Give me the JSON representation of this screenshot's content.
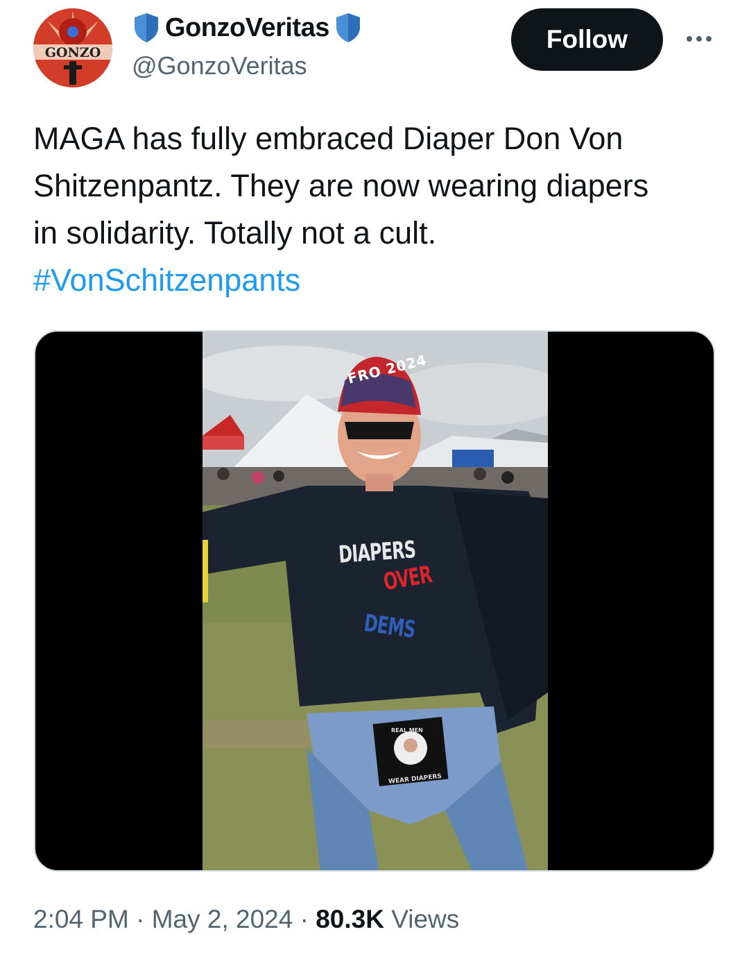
{
  "author": {
    "display_name": "GonzoVeritas",
    "handle": "@GonzoVeritas",
    "avatar_text": "GONZO",
    "badge_color": "#4a90d9"
  },
  "actions": {
    "follow_label": "Follow",
    "more_icon": "more-horizontal-icon"
  },
  "tweet": {
    "text_lines": [
      "MAGA has fully embraced Diaper Don Von",
      "Shitzenpantz. They are now wearing diapers",
      "in solidarity. Totally not a cult."
    ],
    "hashtag": "#VonSchitzenpants"
  },
  "media": {
    "shirt_line1": "DIAPERS",
    "shirt_line2": "OVER",
    "shirt_line3": "DEMS",
    "hat_text": "FRO 2024",
    "badge_top": "REAL MEN",
    "badge_bottom": "WEAR DIAPERS"
  },
  "meta": {
    "time": "2:04 PM",
    "separator": "·",
    "date": "May 2, 2024",
    "views_count": "80.3K",
    "views_label": "Views"
  },
  "colors": {
    "text": "#0f1419",
    "secondary": "#536471",
    "link": "#1d9bf0",
    "button_bg": "#0f1419"
  }
}
